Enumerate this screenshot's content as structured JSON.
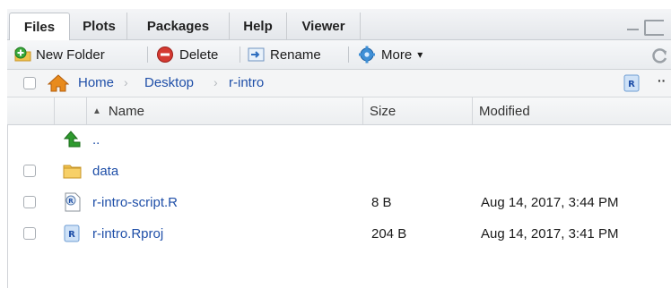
{
  "tabs": [
    {
      "label": "Files",
      "active": true
    },
    {
      "label": "Plots",
      "active": false
    },
    {
      "label": "Packages",
      "active": false
    },
    {
      "label": "Help",
      "active": false
    },
    {
      "label": "Viewer",
      "active": false
    }
  ],
  "toolbar": {
    "new_folder": "New Folder",
    "delete": "Delete",
    "rename": "Rename",
    "more": "More",
    "more_caret": "▾"
  },
  "breadcrumb": {
    "items": [
      "Home",
      "Desktop",
      "r-intro"
    ],
    "separator": "›",
    "overflow": "··"
  },
  "table": {
    "headers": {
      "name": "Name",
      "size": "Size",
      "modified": "Modified"
    },
    "sort_indicator": "▲",
    "rows": [
      {
        "name": "..",
        "size": "",
        "modified": "",
        "icon": "up-arrow-icon",
        "checkbox": false
      },
      {
        "name": "data",
        "size": "",
        "modified": "",
        "icon": "folder-icon",
        "checkbox": true
      },
      {
        "name": "r-intro-script.R",
        "size": "8 B",
        "modified": "Aug 14, 2017, 3:44 PM",
        "icon": "r-script-icon",
        "checkbox": true
      },
      {
        "name": "r-intro.Rproj",
        "size": "204 B",
        "modified": "Aug 14, 2017, 3:41 PM",
        "icon": "rproj-icon",
        "checkbox": true
      }
    ]
  },
  "colors": {
    "link": "#1f4fa8",
    "up_arrow": "#2e9a2e",
    "folder": "#e8b84a",
    "delete_red": "#c9302c",
    "rproj_blue": "#4a8fd8"
  }
}
